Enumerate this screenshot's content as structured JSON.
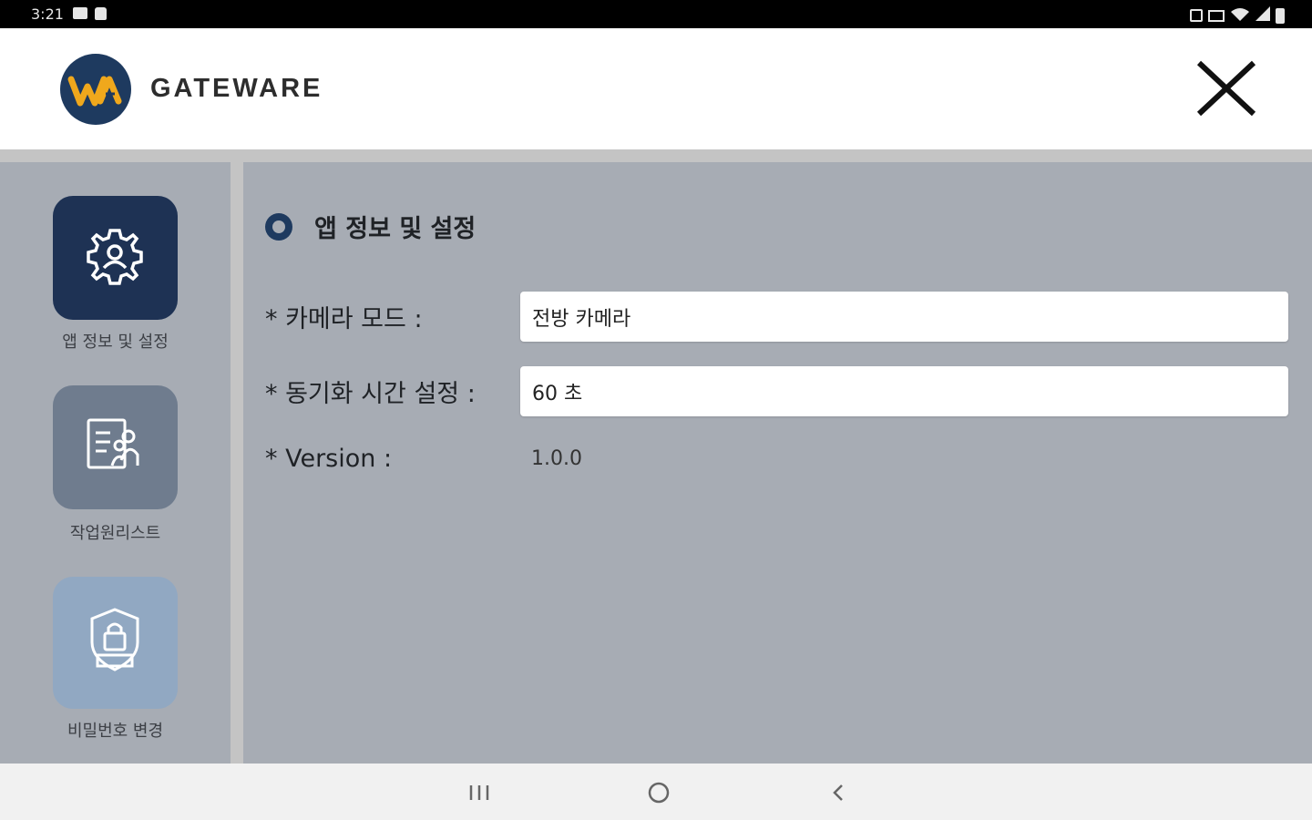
{
  "status_bar": {
    "time": "3:21",
    "left_icons": [
      "gallery-icon",
      "notification-icon"
    ],
    "right_icons": [
      "silent-icon",
      "volte-icon",
      "wifi-icon",
      "signal-icon",
      "battery-icon"
    ]
  },
  "header": {
    "logo_text": "WA",
    "brand_name": "GATEWARE",
    "close_icon": "close-icon",
    "colors": {
      "brand_navy": "#1e3a5f",
      "brand_gold": "#f0a81c"
    }
  },
  "sidebar": {
    "items": [
      {
        "label": "앱 정보 및 설정",
        "icon": "gear-user-icon",
        "active": true
      },
      {
        "label": "작업원리스트",
        "icon": "worker-list-icon",
        "active": false
      },
      {
        "label": "비밀번호 변경",
        "icon": "shield-lock-icon",
        "active": false
      }
    ]
  },
  "main": {
    "section_title": "앱 정보 및 설정",
    "camera_mode_label": "* 카메라 모드 :",
    "camera_mode_value": "전방 카메라",
    "sync_label": "* 동기화 시간 설정 :",
    "sync_value": "60 초",
    "version_label": "* Version :",
    "version_value": "1.0.0"
  },
  "nav_bar": {
    "icons": [
      "recent-apps-icon",
      "home-icon",
      "back-icon"
    ]
  }
}
